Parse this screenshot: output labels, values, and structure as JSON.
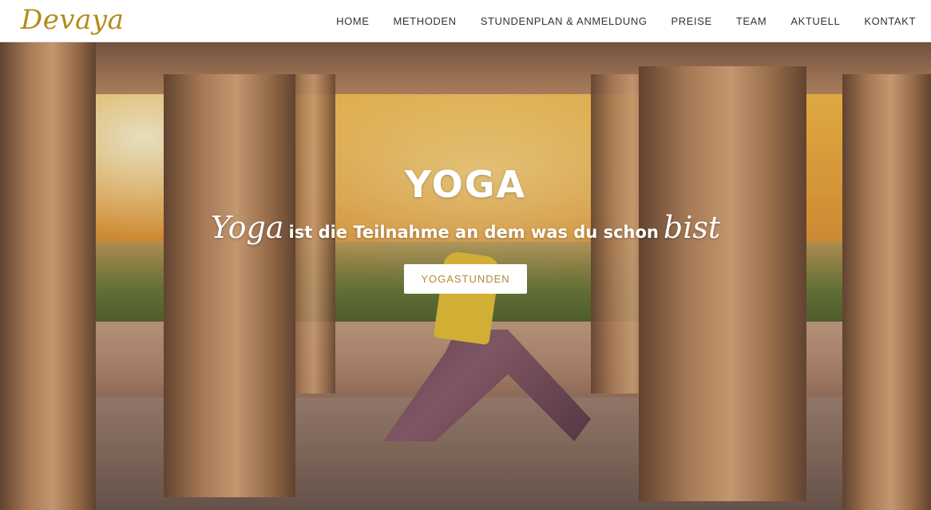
{
  "brand": {
    "logo_text": "Devaya",
    "accent_color": "#b38b1c"
  },
  "nav": {
    "items": [
      {
        "label": "HOME"
      },
      {
        "label": "METHODEN"
      },
      {
        "label": "STUNDENPLAN & ANMELDUNG"
      },
      {
        "label": "PREISE"
      },
      {
        "label": "TEAM"
      },
      {
        "label": "AKTUELL"
      },
      {
        "label": "KONTAKT"
      }
    ]
  },
  "hero": {
    "title": "YOGA",
    "subtitle_script_start": "Yoga",
    "subtitle_middle": "ist die Teilnahme an dem was du schon",
    "subtitle_script_end": "bist",
    "button_label": "YOGASTUNDEN",
    "button_text_color": "#b0893a"
  }
}
